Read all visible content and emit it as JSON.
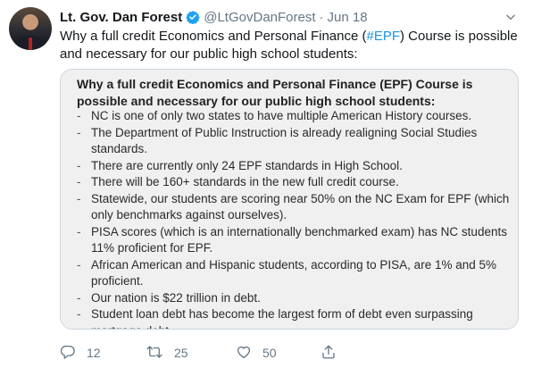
{
  "tweet": {
    "author_name": "Lt. Gov. Dan Forest",
    "handle": "@LtGovDanForest",
    "separator": "·",
    "date": "Jun 18",
    "text_before": "Why a full credit Economics and Personal Finance (",
    "hashtag": "#EPF",
    "text_after": ") Course is possible and necessary for our public high school students:"
  },
  "card": {
    "title": "Why a full credit Economics and Personal Finance (EPF) Course is possible and necessary for our public high school students:",
    "bullet": "-",
    "items": [
      "NC is one of only two states to have multiple American History courses.",
      "The Department of Public Instruction is already realigning Social Studies standards.",
      "There are currently only 24 EPF standards in High School.",
      "There will be 160+ standards in the new full credit course.",
      "Statewide, our students are scoring near 50% on the NC Exam for EPF (which only benchmarks against ourselves).",
      "PISA scores (which is an internationally benchmarked exam) has NC students 11% proficient for EPF.",
      "African American and Hispanic students, according to PISA, are 1% and 5% proficient.",
      "Our nation is $22 trillion in debt.",
      "Student loan debt has become the largest form of debt even surpassing mortgage debt."
    ]
  },
  "actions": {
    "reply_count": "12",
    "retweet_count": "25",
    "like_count": "50"
  },
  "icons": {
    "verified": "verified-badge-icon",
    "caret": "chevron-down-icon",
    "reply": "reply-icon",
    "retweet": "retweet-icon",
    "like": "heart-icon",
    "share": "share-icon"
  },
  "colors": {
    "link": "#1b95e0",
    "secondary_text": "#657786",
    "verified": "#1da1f2",
    "card_bg": "#f0f0f1"
  }
}
